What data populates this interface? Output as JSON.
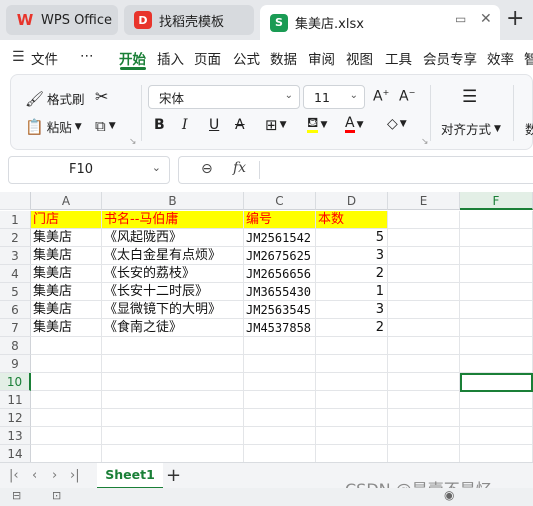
{
  "tabs": [
    {
      "label": "WPS Office",
      "logo": "W",
      "logo_color": "#e8342b"
    },
    {
      "label": "找稻壳模板",
      "logo": "D",
      "logo_color": "#e8342b"
    },
    {
      "label": "集美店.xlsx",
      "logo": "S",
      "logo_color": "#1a9b54"
    }
  ],
  "menu": {
    "file": "文件",
    "more": "⋯",
    "items": [
      "开始",
      "插入",
      "页面",
      "公式",
      "数据",
      "审阅",
      "视图",
      "工具",
      "会员专享",
      "效率",
      "智"
    ]
  },
  "ribbon": {
    "format_painter": "格式刷",
    "paste": "粘贴",
    "font_name": "宋体",
    "font_size": "11",
    "align": "对齐方式",
    "trailing": "数"
  },
  "formula_bar": {
    "name_box": "F10",
    "fx": "fx"
  },
  "columns": [
    "A",
    "B",
    "C",
    "D",
    "E",
    "F"
  ],
  "selected_column": "F",
  "rows": [
    "1",
    "2",
    "3",
    "4",
    "5",
    "6",
    "7",
    "8",
    "9",
    "10",
    "11",
    "12",
    "13",
    "14"
  ],
  "selected_row": "10",
  "table": {
    "header": [
      "门店",
      "书名--马伯庸",
      "编号",
      "本数"
    ],
    "data": [
      [
        "集美店",
        "《风起陇西》",
        "JM2561542",
        "5"
      ],
      [
        "集美店",
        "《太白金星有点烦》",
        "JM2675625",
        "3"
      ],
      [
        "集美店",
        "《长安的荔枝》",
        "JM2656656",
        "2"
      ],
      [
        "集美店",
        "《长安十二时辰》",
        "JM3655430",
        "1"
      ],
      [
        "集美店",
        "《显微镜下的大明》",
        "JM2563545",
        "3"
      ],
      [
        "集美店",
        "《食南之徒》",
        "JM4537858",
        "2"
      ]
    ]
  },
  "sheet": {
    "name": "Sheet1"
  },
  "watermark": "CSDN @是壹不是忆",
  "colors": {
    "accent": "#1a7f37",
    "header_fill": "#ffff00",
    "header_text": "#ff0000"
  }
}
